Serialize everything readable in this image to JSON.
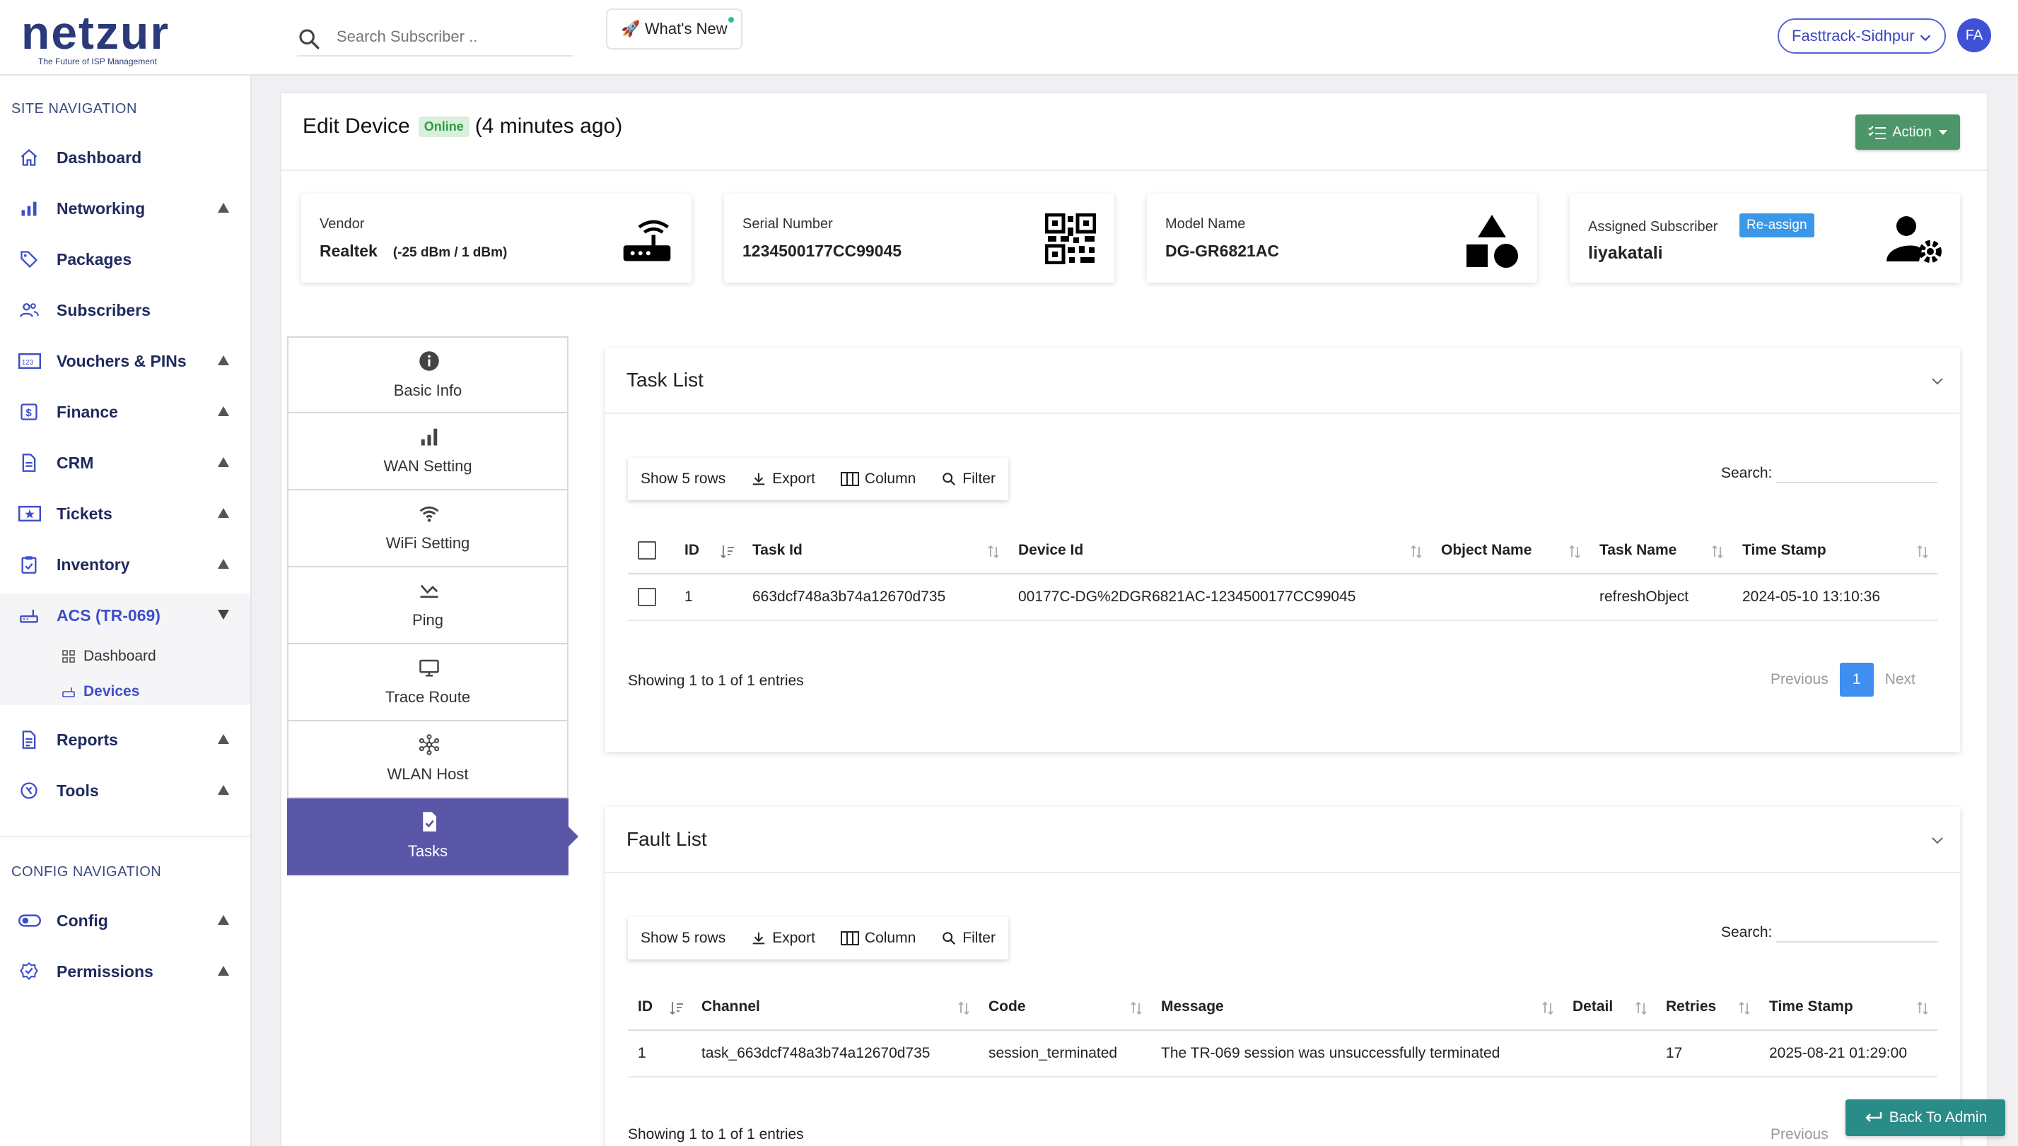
{
  "brand": {
    "name": "netzur",
    "tagline": "The Future of ISP Management"
  },
  "header": {
    "search_placeholder": "Search Subscriber ..",
    "whats_new": "🚀 What's New",
    "site": "Fasttrack-Sidhpur",
    "avatar_initials": "FA"
  },
  "sidebar": {
    "site_heading": "SITE NAVIGATION",
    "config_heading": "CONFIG NAVIGATION",
    "items": [
      {
        "label": "Dashboard",
        "icon": "home-icon"
      },
      {
        "label": "Networking",
        "icon": "bar-chart-icon"
      },
      {
        "label": "Packages",
        "icon": "tag-icon"
      },
      {
        "label": "Subscribers",
        "icon": "users-icon"
      },
      {
        "label": "Vouchers & PINs",
        "icon": "voucher-icon"
      },
      {
        "label": "Finance",
        "icon": "dollar-icon"
      },
      {
        "label": "CRM",
        "icon": "document-icon"
      },
      {
        "label": "Tickets",
        "icon": "ticket-icon"
      },
      {
        "label": "Inventory",
        "icon": "clipboard-icon"
      },
      {
        "label": "ACS (TR-069)",
        "icon": "router-icon"
      },
      {
        "label": "Reports",
        "icon": "report-icon"
      },
      {
        "label": "Tools",
        "icon": "tools-icon"
      }
    ],
    "acs_sub": [
      {
        "label": "Dashboard",
        "icon": "grid-icon"
      },
      {
        "label": "Devices",
        "icon": "router-icon"
      }
    ],
    "config_items": [
      {
        "label": "Config",
        "icon": "toggle-icon"
      },
      {
        "label": "Permissions",
        "icon": "badge-check-icon"
      }
    ]
  },
  "page": {
    "title": "Edit Device",
    "status": "Online",
    "status_color": "#2f9c42",
    "last_seen": "(4 minutes ago)",
    "action_label": "Action",
    "action_color": "#4d9669"
  },
  "info_cards": {
    "vendor": {
      "caption": "Vendor",
      "value": "Realtek",
      "extra": "(-25 dBm / 1 dBm)"
    },
    "serial": {
      "caption": "Serial Number",
      "value": "1234500177CC99045"
    },
    "model": {
      "caption": "Model Name",
      "value": "DG-GR6821AC"
    },
    "subscriber": {
      "caption": "Assigned Subscriber",
      "value": "liyakatali",
      "reassign": "Re-assign"
    }
  },
  "tabs": [
    {
      "label": "Basic Info",
      "icon": "info-icon"
    },
    {
      "label": "WAN Setting",
      "icon": "signal-icon"
    },
    {
      "label": "WiFi Setting",
      "icon": "wifi-icon"
    },
    {
      "label": "Ping",
      "icon": "ping-icon"
    },
    {
      "label": "Trace Route",
      "icon": "monitor-icon"
    },
    {
      "label": "WLAN Host",
      "icon": "network-icon"
    },
    {
      "label": "Tasks",
      "icon": "task-file-icon"
    }
  ],
  "toolbar": {
    "show_rows": "Show 5 rows",
    "export": "Export",
    "column": "Column",
    "filter": "Filter",
    "search_label": "Search:"
  },
  "task_list": {
    "title": "Task List",
    "columns": [
      "ID",
      "Task Id",
      "Device Id",
      "Object Name",
      "Task Name",
      "Time Stamp"
    ],
    "rows": [
      {
        "id": "1",
        "task_id": "663dcf748a3b74a12670d735",
        "device_id": "00177C-DG%2DGR6821AC-1234500177CC99045",
        "object_name": "",
        "task_name": "refreshObject",
        "time_stamp": "2024-05-10 13:10:36"
      }
    ],
    "showing": "Showing 1 to 1 of 1 entries",
    "pager": {
      "previous": "Previous",
      "current": "1",
      "next": "Next"
    }
  },
  "fault_list": {
    "title": "Fault List",
    "columns": [
      "ID",
      "Channel",
      "Code",
      "Message",
      "Detail",
      "Retries",
      "Time Stamp"
    ],
    "rows": [
      {
        "id": "1",
        "channel": "task_663dcf748a3b74a12670d735",
        "code": "session_terminated",
        "message": "The TR-069 session was unsuccessfully terminated",
        "detail": "",
        "retries": "17",
        "time_stamp": "2025-08-21 01:29:00"
      }
    ],
    "showing": "Showing 1 to 1 of 1 entries",
    "pager": {
      "previous": "Previous"
    }
  },
  "back_to_admin": "Back To Admin",
  "colors": {
    "accent": "#3f4fc9",
    "active_tab": "#5a56a8",
    "pager_active": "#3f8ef0",
    "back_btn": "#2a8c86"
  }
}
